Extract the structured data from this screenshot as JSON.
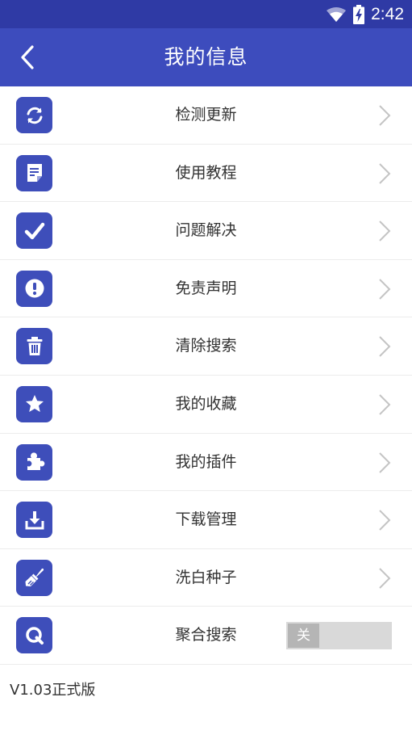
{
  "status_bar": {
    "time": "2:42",
    "icons": [
      "wifi-icon",
      "battery-charging-icon"
    ]
  },
  "header": {
    "title": "我的信息",
    "back_icon": "chevron-left-icon",
    "color": "#3d4cbd"
  },
  "menu": {
    "items": [
      {
        "label": "检测更新",
        "icon": "refresh-icon"
      },
      {
        "label": "使用教程",
        "icon": "document-icon"
      },
      {
        "label": "问题解决",
        "icon": "checkmark-icon"
      },
      {
        "label": "免责声明",
        "icon": "exclamation-icon"
      },
      {
        "label": "清除搜索",
        "icon": "trash-icon"
      },
      {
        "label": "我的收藏",
        "icon": "star-icon"
      },
      {
        "label": "我的插件",
        "icon": "puzzle-icon"
      },
      {
        "label": "下载管理",
        "icon": "download-icon"
      },
      {
        "label": "洗白种子",
        "icon": "brush-icon"
      },
      {
        "label": "聚合搜索",
        "icon": "search-icon",
        "toggle_label": "关",
        "toggle_on": false
      }
    ],
    "icon_color": "#3e4eba"
  },
  "footer": {
    "version": "V1.03正式版"
  }
}
